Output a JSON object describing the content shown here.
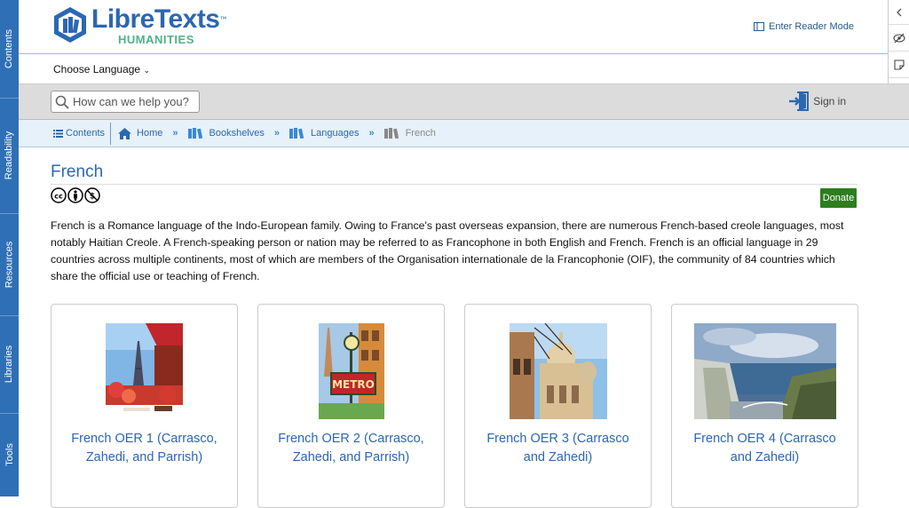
{
  "sidebar": {
    "tabs": [
      {
        "label": "Contents"
      },
      {
        "label": "Readability"
      },
      {
        "label": "Resources"
      },
      {
        "label": "Libraries"
      },
      {
        "label": "Tools"
      }
    ]
  },
  "header": {
    "logo_name": "LibreTexts",
    "logo_tm": "™",
    "logo_sub": "HUMANITIES",
    "reader_mode": "Enter Reader Mode"
  },
  "language": {
    "label": "Choose Language"
  },
  "search": {
    "placeholder": "How can we help you?",
    "signin": "Sign in"
  },
  "breadcrumb": {
    "contents": "Contents",
    "home": "Home",
    "bookshelves": "Bookshelves",
    "languages": "Languages",
    "current": "French"
  },
  "page": {
    "title": "French",
    "donate": "Donate",
    "intro": "French is a Romance language of the Indo-European family. Owing to France's past overseas expansion, there are numerous French-based creole languages, most notably Haitian Creole. A French-speaking person or nation may be referred to as Francophone in both English and French. French is an official language in 29 countries across multiple continents, most of which are members of the Organisation internationale de la Francophonie (OIF), the community of 84 countries which share the official use or teaching of French."
  },
  "cards": [
    {
      "title": "French OER 1 (Carrasco, Zahedi, and Parrish)",
      "image": "paris-cafe-eiffel-image"
    },
    {
      "title": "French OER 2 (Carrasco, Zahedi, and Parrish)",
      "image": "metro-sign-image"
    },
    {
      "title": "French OER 3 (Carrasco and Zahedi)",
      "image": "sacre-coeur-image"
    },
    {
      "title": "French OER 4 (Carrasco and Zahedi)",
      "image": "etretat-cliffs-image"
    }
  ],
  "colors": {
    "brand_blue": "#2c67b2",
    "brand_green": "#4fb28a",
    "sidebar": "#2f6fb6",
    "donate": "#2e7d1e"
  }
}
